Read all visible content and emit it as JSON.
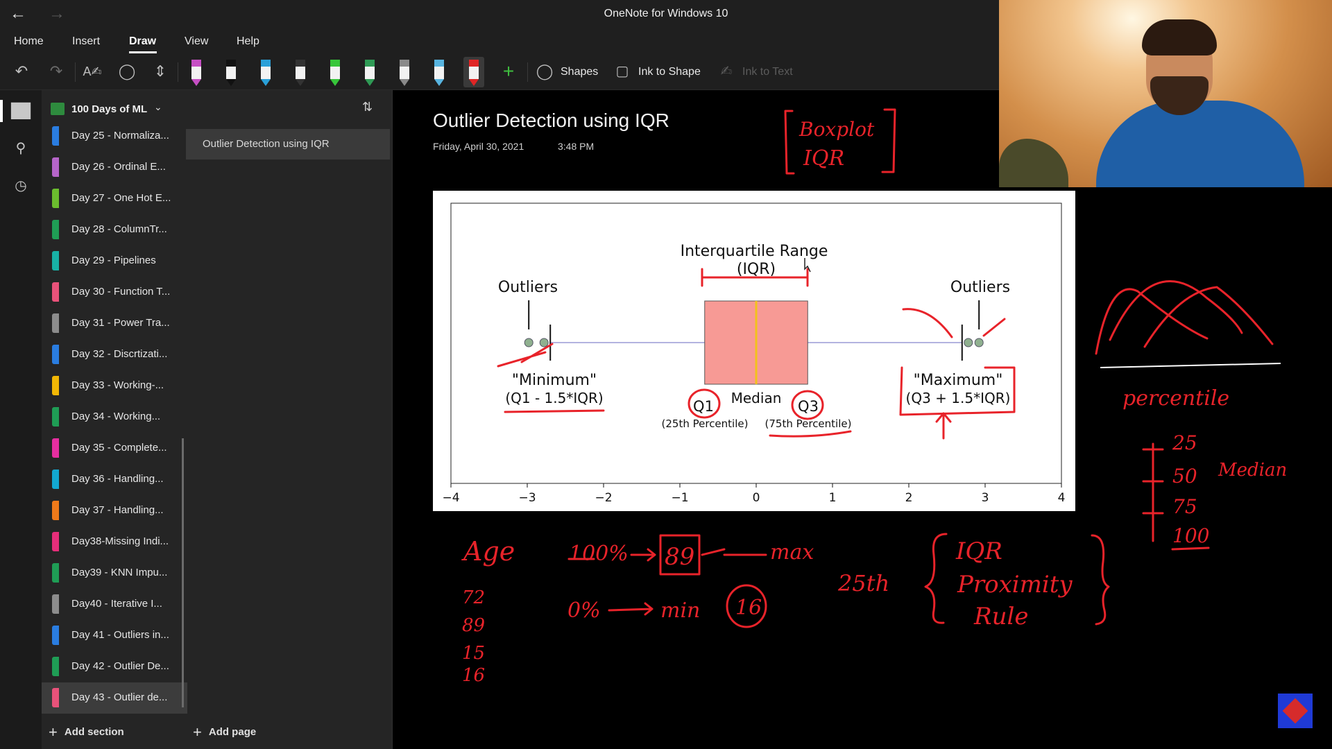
{
  "app": {
    "title": "OneNote for Windows 10",
    "back_icon": "arrow-left-icon",
    "forward_icon": "arrow-right-icon"
  },
  "menu": {
    "items": [
      "Home",
      "Insert",
      "Draw",
      "View",
      "Help"
    ],
    "active": "Draw"
  },
  "ribbon": {
    "shapes_label": "Shapes",
    "ink_to_shape_label": "Ink to Shape",
    "ink_to_text_label": "Ink to Text",
    "pens": [
      {
        "color": "#c64fc4",
        "name": "highlighter-purple"
      },
      {
        "color": "#111111",
        "name": "pen-black"
      },
      {
        "color": "#2aa0d8",
        "name": "pen-blue"
      },
      {
        "color": "#333333",
        "name": "pen-dark"
      },
      {
        "color": "#37c63a",
        "name": "highlighter-green"
      },
      {
        "color": "#2f9a55",
        "name": "pen-green"
      },
      {
        "color": "#8a8a8a",
        "name": "pencil-gray"
      },
      {
        "color": "#58b4e0",
        "name": "pen-lightblue"
      },
      {
        "color": "#e02525",
        "name": "pen-red"
      }
    ]
  },
  "notebook": {
    "name": "100 Days of ML"
  },
  "sections": [
    {
      "label": "Day 25 - Normaliza...",
      "color": "#2a7de1"
    },
    {
      "label": "Day 26 - Ordinal E...",
      "color": "#b665c9"
    },
    {
      "label": "Day 27 - One Hot E...",
      "color": "#6bbd2e"
    },
    {
      "label": "Day 28 - ColumnTr...",
      "color": "#1f9d55"
    },
    {
      "label": "Day 29 - Pipelines",
      "color": "#18b1a6"
    },
    {
      "label": "Day 30 - Function T...",
      "color": "#e9527a"
    },
    {
      "label": "Day 31 - Power Tra...",
      "color": "#8c8c8c"
    },
    {
      "label": "Day 32 - Discrtizati...",
      "color": "#2a7de1"
    },
    {
      "label": "Day 33 - Working-...",
      "color": "#f2b705"
    },
    {
      "label": "Day 34 - Working...",
      "color": "#1f9d55"
    },
    {
      "label": "Day 35 - Complete...",
      "color": "#e62ea0"
    },
    {
      "label": "Day 36 - Handling...",
      "color": "#12a8d1"
    },
    {
      "label": "Day 37 - Handling...",
      "color": "#f07a1a"
    },
    {
      "label": "Day38-Missing Indi...",
      "color": "#e62e7a"
    },
    {
      "label": "Day39 - KNN Impu...",
      "color": "#1f9d55"
    },
    {
      "label": "Day40 - Iterative I...",
      "color": "#8c8c8c"
    },
    {
      "label": "Day 41 - Outliers in...",
      "color": "#2a7de1"
    },
    {
      "label": "Day 42 - Outlier De...",
      "color": "#1f9d55"
    },
    {
      "label": "Day 43 - Outlier de...",
      "color": "#e9527a"
    }
  ],
  "selected_section_index": 18,
  "pages": [
    {
      "label": "Outlier Detection using IQR"
    }
  ],
  "footer": {
    "add_section": "Add section",
    "add_page": "Add page"
  },
  "note": {
    "title": "Outlier Detection using IQR",
    "date": "Friday, April 30, 2021",
    "time": "3:48 PM"
  },
  "figure": {
    "title_line1": "Interquartile Range",
    "title_line2": "(IQR)",
    "outliers_left": "Outliers",
    "outliers_right": "Outliers",
    "minimum_line1": "\"Minimum\"",
    "minimum_line2": "(Q1 - 1.5*IQR)",
    "maximum_line1": "\"Maximum\"",
    "maximum_line2": "(Q3 + 1.5*IQR)",
    "q1": "Q1",
    "median": "Median",
    "q3": "Q3",
    "q1_note": "(25th Percentile)",
    "q3_note": "(75th Percentile)",
    "x_ticks": [
      "−4",
      "−3",
      "−2",
      "−1",
      "0",
      "1",
      "2",
      "3",
      "4"
    ],
    "box": {
      "q1": -0.675,
      "median": 0,
      "q3": 0.675,
      "whisker_low": -2.698,
      "whisker_high": 2.698
    },
    "outlier_points_left": [
      -2.98,
      -2.78
    ],
    "outlier_points_right": [
      2.78,
      2.92
    ],
    "xlim": [
      -4,
      4
    ],
    "box_color": "#f79a95",
    "median_color": "#f2c21b",
    "whisker_color": "#9a9ad6"
  },
  "ink": {
    "boxplot": "Boxplot",
    "iqr": "IQR",
    "percentile": "percentile",
    "p25": "25",
    "p50": "50",
    "median": "Median",
    "p75": "75",
    "p100": "100",
    "age": "Age",
    "ages": [
      "72",
      "89",
      "15",
      "16"
    ],
    "pct100": "100%",
    "v89": "89",
    "max": "max",
    "pct0": "0%",
    "min": "min",
    "v16": "16",
    "p25th": "25th",
    "iqr_rule": "IQR",
    "proximity": "Proximity",
    "rule": "Rule",
    "color": "#e8232a"
  }
}
